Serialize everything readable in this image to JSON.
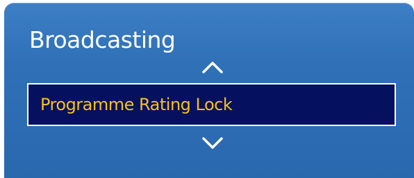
{
  "menu": {
    "title": "Broadcasting",
    "selected_item": "Programme Rating Lock",
    "scroll_up_icon": "chevron-up-icon",
    "scroll_down_icon": "chevron-down-icon"
  },
  "colors": {
    "panel_background": "#2f70b7",
    "selected_background": "#05105f",
    "selected_text": "#f5c11a",
    "title_text": "#ffffff"
  }
}
